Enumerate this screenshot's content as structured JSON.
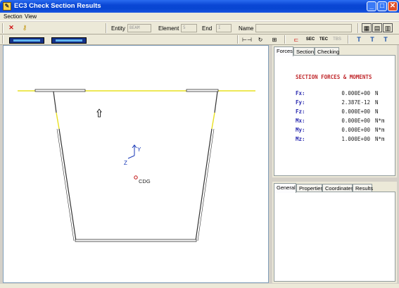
{
  "window": {
    "title": "EC3 Check Section Results"
  },
  "menu": {
    "section": "Section",
    "view": "View"
  },
  "toolbar": {
    "entity_label": "Entity",
    "entity_value": "BEAM",
    "element_label": "Element",
    "element_value": "5",
    "end_label": "End",
    "end_value": "I",
    "name_label": "Name",
    "name_value": ""
  },
  "canvas": {
    "axis_y": "Y",
    "axis_z": "Z",
    "cog_label": "CDG"
  },
  "forces_tabs": [
    "Forces",
    "Section",
    "Checking"
  ],
  "forces": {
    "heading": "SECTION FORCES & MOMENTS",
    "rows": [
      {
        "key": "Fx:",
        "value": "0.000E+00",
        "unit": "N"
      },
      {
        "key": "Fy:",
        "value": "2.387E-12",
        "unit": "N"
      },
      {
        "key": "Fz:",
        "value": "0.000E+00",
        "unit": "N"
      },
      {
        "key": "Mx:",
        "value": "0.000E+00",
        "unit": "N*m"
      },
      {
        "key": "My:",
        "value": "0.000E+00",
        "unit": "N*m"
      },
      {
        "key": "Mz:",
        "value": "1.000E+00",
        "unit": "N*m"
      }
    ]
  },
  "info_tabs": [
    "General",
    "Properties",
    "Coordinates",
    "Results"
  ],
  "colors": {
    "accent_yellow": "#e8e020",
    "title_red": "#c0282c",
    "key_blue": "#2a2ab0"
  }
}
